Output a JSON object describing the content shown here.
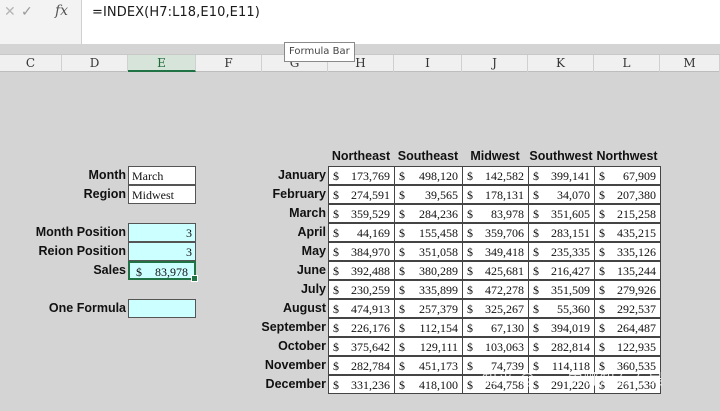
{
  "formula_bar": {
    "cancel_icon": "✓",
    "enter_icon": "✓",
    "fx_label": "fx",
    "formula": "=INDEX(H7:L18,E10,E11)",
    "tooltip": "Formula Bar"
  },
  "columns": [
    {
      "label": "C"
    },
    {
      "label": "D"
    },
    {
      "label": "E",
      "selected": true
    },
    {
      "label": "F"
    },
    {
      "label": "G"
    },
    {
      "label": "H"
    },
    {
      "label": "I"
    },
    {
      "label": "J"
    },
    {
      "label": "K"
    },
    {
      "label": "L"
    },
    {
      "label": "M"
    }
  ],
  "inputs": {
    "month_label": "Month",
    "month_value": "March",
    "region_label": "Region",
    "region_value": "Midwest",
    "month_position_label": "Month Position",
    "month_position_value": "3",
    "region_position_label": "Reion Position",
    "region_position_value": "3",
    "sales_label": "Sales",
    "sales_currency": "$",
    "sales_value": "83,978",
    "one_formula_label": "One Formula",
    "one_formula_value": ""
  },
  "table": {
    "regions": [
      "Northeast",
      "Southeast",
      "Midwest",
      "Southwest",
      "Northwest"
    ],
    "currency": "$",
    "rows": [
      {
        "month": "January",
        "values": [
          "173,769",
          "498,120",
          "142,582",
          "399,141",
          "67,909"
        ]
      },
      {
        "month": "February",
        "values": [
          "274,591",
          "39,565",
          "178,131",
          "34,070",
          "207,380"
        ]
      },
      {
        "month": "March",
        "values": [
          "359,529",
          "284,236",
          "83,978",
          "351,605",
          "215,258"
        ]
      },
      {
        "month": "April",
        "values": [
          "44,169",
          "155,458",
          "359,706",
          "283,151",
          "435,215"
        ]
      },
      {
        "month": "May",
        "values": [
          "384,970",
          "351,058",
          "349,418",
          "235,335",
          "335,126"
        ]
      },
      {
        "month": "June",
        "values": [
          "392,488",
          "380,289",
          "425,681",
          "216,427",
          "135,244"
        ]
      },
      {
        "month": "July",
        "values": [
          "230,259",
          "335,899",
          "472,278",
          "351,509",
          "279,926"
        ]
      },
      {
        "month": "August",
        "values": [
          "474,913",
          "257,379",
          "325,267",
          "55,360",
          "292,537"
        ]
      },
      {
        "month": "September",
        "values": [
          "226,176",
          "112,154",
          "67,130",
          "394,019",
          "264,487"
        ]
      },
      {
        "month": "October",
        "values": [
          "375,642",
          "129,111",
          "103,063",
          "282,814",
          "122,935"
        ]
      },
      {
        "month": "November",
        "values": [
          "282,784",
          "451,173",
          "74,739",
          "114,118",
          "360,535"
        ]
      },
      {
        "month": "December",
        "values": [
          "331,236",
          "418,100",
          "264,758",
          "291,220",
          "261,530"
        ]
      }
    ]
  },
  "watermark": "知乎 @一一中哪知石吞吴"
}
